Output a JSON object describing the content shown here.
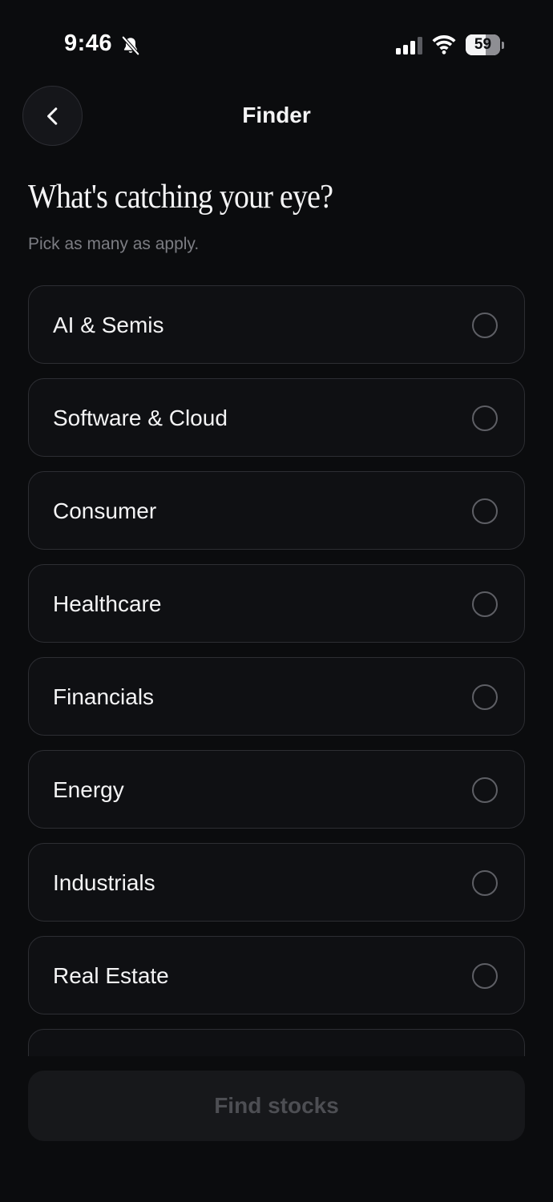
{
  "status_bar": {
    "time": "9:46",
    "battery_level": "59",
    "icons": [
      "bell-slash-icon",
      "cellular-signal-icon",
      "wifi-icon",
      "battery-icon"
    ]
  },
  "header": {
    "title": "Finder",
    "back_icon": "chevron-left-icon"
  },
  "question": {
    "heading": "What's catching your eye?",
    "subtitle": "Pick as many as apply."
  },
  "options": [
    {
      "label": "AI & Semis",
      "selected": false
    },
    {
      "label": "Software & Cloud",
      "selected": false
    },
    {
      "label": "Consumer",
      "selected": false
    },
    {
      "label": "Healthcare",
      "selected": false
    },
    {
      "label": "Financials",
      "selected": false
    },
    {
      "label": "Energy",
      "selected": false
    },
    {
      "label": "Industrials",
      "selected": false
    },
    {
      "label": "Real Estate",
      "selected": false
    },
    {
      "label": "",
      "selected": false
    }
  ],
  "cta": {
    "label": "Find stocks",
    "enabled": false
  },
  "colors": {
    "background": "#0b0c0e",
    "card_border": "#2d2e33",
    "text_primary": "#f4f4f5",
    "text_secondary": "#7c7d83",
    "cta_disabled_bg": "#17181b",
    "cta_disabled_text": "#4d4e53"
  }
}
